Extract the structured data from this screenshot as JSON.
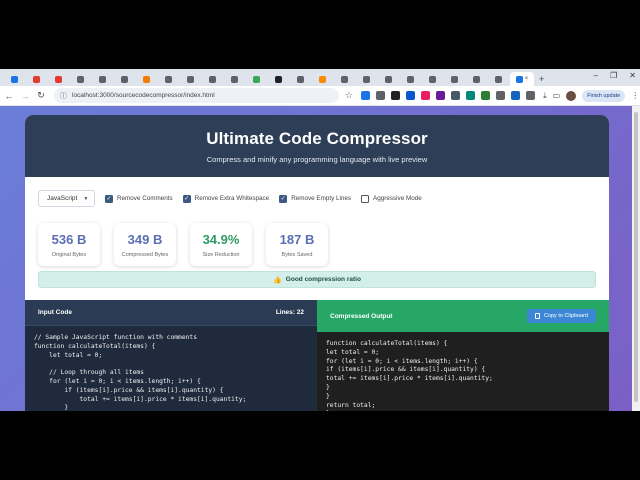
{
  "browser": {
    "tabs": [
      {
        "color": "#1a73e8"
      },
      {
        "color": "#e53935"
      },
      {
        "color": "#e53935"
      },
      {
        "color": "#5f6368"
      },
      {
        "color": "#5f6368"
      },
      {
        "color": "#5f6368"
      },
      {
        "color": "#f57c00"
      },
      {
        "color": "#5f6368"
      },
      {
        "color": "#5f6368"
      },
      {
        "color": "#5f6368"
      },
      {
        "color": "#5f6368"
      },
      {
        "color": "#34a853"
      },
      {
        "color": "#202124"
      },
      {
        "color": "#5f6368"
      },
      {
        "color": "#fb8c00"
      },
      {
        "color": "#5f6368"
      },
      {
        "color": "#5f6368"
      },
      {
        "color": "#5f6368"
      },
      {
        "color": "#5f6368"
      },
      {
        "color": "#5f6368"
      },
      {
        "color": "#5f6368"
      },
      {
        "color": "#5f6368"
      },
      {
        "color": "#5f6368"
      },
      {
        "color": "#1a73e8"
      }
    ],
    "active_tab_close": "×",
    "new_tab": "+",
    "window_controls": {
      "minimize": "–",
      "restore": "❐",
      "close": "✕"
    },
    "url": "localhost:3000/sourcecodecompressor/index.html",
    "update_label": "Finish update",
    "extension_colors": [
      "#1a73e8",
      "#5f6368",
      "#202124",
      "#0b57d0",
      "#e91e63",
      "#6a1b9a",
      "#455a64",
      "#00897b",
      "#2e7d32",
      "#5f6368",
      "#1565c0",
      "#5f6368"
    ]
  },
  "app": {
    "title": "Ultimate Code Compressor",
    "subtitle": "Compress and minify any programming language with live preview",
    "language": "JavaScript",
    "options": [
      {
        "label": "Remove Comments",
        "checked": true
      },
      {
        "label": "Remove Extra Whitespace",
        "checked": true
      },
      {
        "label": "Remove Empty Lines",
        "checked": true
      },
      {
        "label": "Aggressive Mode",
        "checked": false
      }
    ],
    "stats": [
      {
        "value": "536 B",
        "label": "Original Bytes"
      },
      {
        "value": "349 B",
        "label": "Compressed Bytes"
      },
      {
        "value": "34.9%",
        "label": "Size Reduction"
      },
      {
        "value": "187 B",
        "label": "Bytes Saved"
      }
    ],
    "ratio_message": "Good compression ratio",
    "input": {
      "title": "Input Code",
      "lines_label": "Lines: 22",
      "code": "// Sample JavaScript function with comments\nfunction calculateTotal(items) {\n    let total = 0;\n\n    // Loop through all items\n    for (let i = 0; i < items.length; i++) {\n        if (items[i].price && items[i].quantity) {\n            total += items[i].price * items[i].quantity;\n        }\n    }"
    },
    "output": {
      "title": "Compressed Output",
      "copy_label": "Copy to Clipboard",
      "code": "function calculateTotal(items) {\nlet total = 0;\nfor (let i = 0; i < items.length; i++) {\nif (items[i].price && items[i].quantity) {\ntotal += items[i].price * items[i].quantity;\n}\n}\nreturn total;\n}"
    }
  }
}
